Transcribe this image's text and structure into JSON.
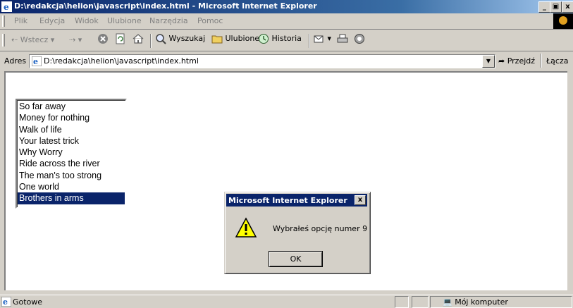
{
  "window": {
    "title": "D:\\redakcja\\helion\\javascript\\index.html - Microsoft Internet Explorer"
  },
  "menu": [
    "Plik",
    "Edycja",
    "Widok",
    "Ulubione",
    "Narzędzia",
    "Pomoc"
  ],
  "toolbar": {
    "back": "Wstecz",
    "search": "Wyszukaj",
    "favorites": "Ulubione",
    "history": "Historia"
  },
  "address": {
    "label": "Adres",
    "url": "D:\\redakcja\\helion\\javascript\\index.html",
    "go": "Przejdź",
    "links": "Łącza"
  },
  "listbox": {
    "options": [
      "So far away",
      "Money for nothing",
      "Walk of life",
      "Your latest trick",
      "Why Worry",
      "Ride across the river",
      "The man's too strong",
      "One world",
      "Brothers in arms"
    ],
    "selected_index": 8
  },
  "dialog": {
    "title": "Microsoft Internet Explorer",
    "message": "Wybrałeś opcję numer 9",
    "ok": "OK"
  },
  "status": {
    "text": "Gotowe",
    "zone": "Mój komputer"
  },
  "colors": {
    "titlebar": "#0a246a",
    "selection": "#0a246a",
    "chrome": "#d4d0c8"
  }
}
